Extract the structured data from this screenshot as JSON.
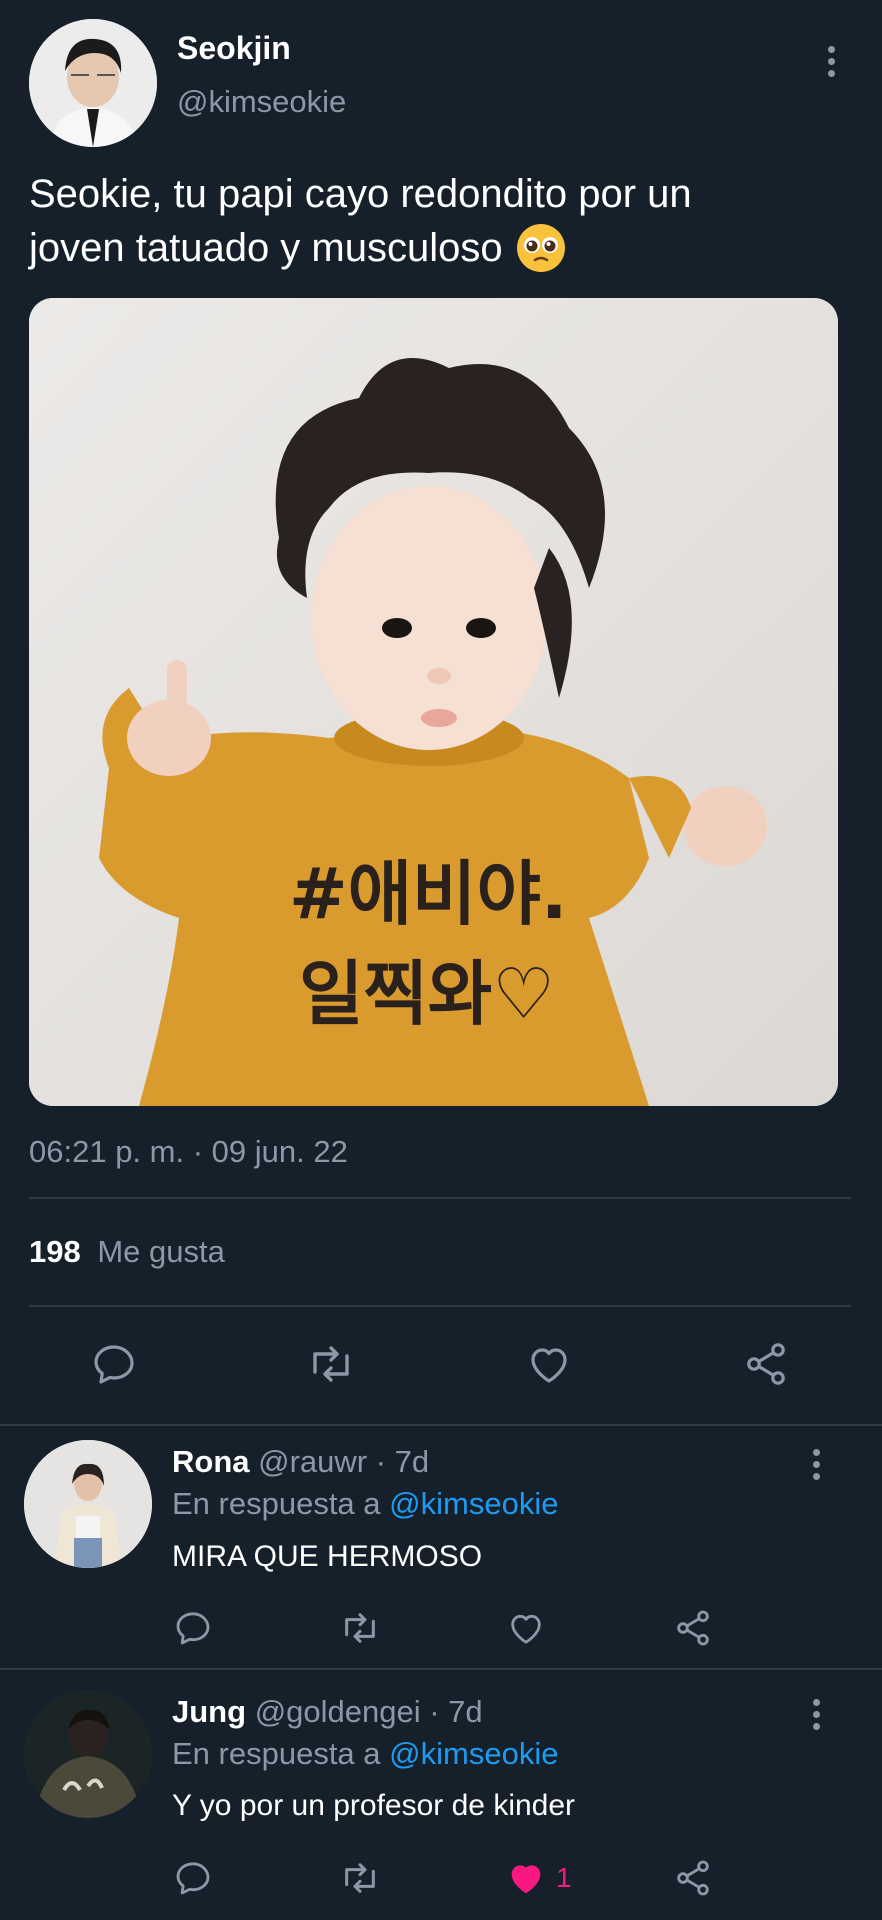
{
  "colors": {
    "background": "#15202b",
    "muted_text": "#8b98a5",
    "link": "#1d9bf0",
    "like_active": "#f91880",
    "divider": "#2f3b47"
  },
  "tweet": {
    "author_name": "Seokjin",
    "author_handle": "@kimseokie",
    "text_line1": "Seokie, tu papi cayo redondito por un",
    "text_line2": "joven tatuado y musculoso",
    "emoji": "pleading-face-emoji",
    "image_shirt_line1": "#애비야.",
    "image_shirt_line2": "일찍와♡",
    "timestamp": "06:21 p. m. · 09 jun. 22",
    "likes_count": "198",
    "likes_label": "Me gusta",
    "actions": [
      "reply-icon",
      "retweet-icon",
      "like-icon",
      "share-icon"
    ]
  },
  "replies": [
    {
      "name": "Rona",
      "handle": "@rauwr",
      "time": "· 7d",
      "reply_prefix": "En respuesta a",
      "reply_to": "@kimseokie",
      "text": "MIRA QUE HERMOSO",
      "liked": false,
      "like_count": ""
    },
    {
      "name": "Jung",
      "handle": "@goldengei",
      "time": "· 7d",
      "reply_prefix": "En respuesta a",
      "reply_to": "@kimseokie",
      "text": "Y yo por un profesor de kinder",
      "liked": true,
      "like_count": "1"
    }
  ]
}
